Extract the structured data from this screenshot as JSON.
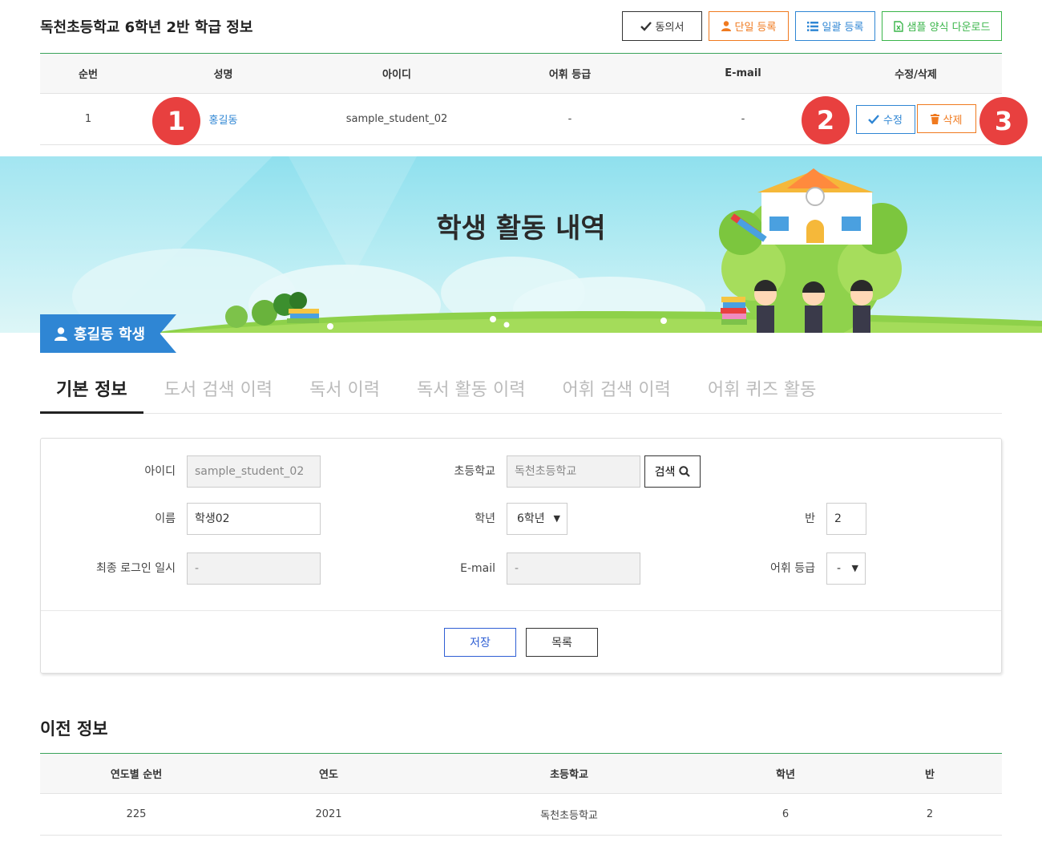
{
  "header": {
    "title": "독천초등학교 6학년 2반 학급 정보",
    "buttons": {
      "consent": "동의서",
      "single_register": "단일 등록",
      "bulk_register": "일괄 등록",
      "sample_download": "샘플 양식 다운로드"
    }
  },
  "student_table": {
    "columns": [
      "순번",
      "성명",
      "아이디",
      "어휘 등급",
      "E-mail",
      "수정/삭제"
    ],
    "rows": [
      {
        "no": "1",
        "name": "홍길동",
        "id": "sample_student_02",
        "vocab_grade": "-",
        "email": "-",
        "edit": "수정",
        "delete": "삭제"
      }
    ]
  },
  "badges": [
    "1",
    "2",
    "3"
  ],
  "banner": {
    "title": "학생 활동 내역",
    "student_tag": "홍길동 학생"
  },
  "tabs": [
    "기본 정보",
    "도서 검색 이력",
    "독서 이력",
    "독서 활동 이력",
    "어휘 검색 이력",
    "어휘 퀴즈 활동"
  ],
  "form": {
    "id_label": "아이디",
    "id_value": "sample_student_02",
    "school_label": "초등학교",
    "school_value": "독천초등학교",
    "search_button": "검색",
    "name_label": "이름",
    "name_value": "학생02",
    "grade_label": "학년",
    "grade_value": "6학년",
    "class_label": "반",
    "class_value": "2",
    "last_login_label": "최종 로그인 일시",
    "last_login_value": "-",
    "email_label": "E-mail",
    "email_value": "-",
    "vocab_label": "어휘 등급",
    "vocab_value": "-",
    "save_button": "저장",
    "list_button": "목록"
  },
  "previous": {
    "title": "이전 정보",
    "columns": [
      "연도별 순번",
      "연도",
      "초등학교",
      "학년",
      "반"
    ],
    "rows": [
      {
        "seq": "225",
        "year": "2021",
        "school": "독천초등학교",
        "grade": "6",
        "class": "2"
      }
    ]
  },
  "colors": {
    "accent_blue": "#2f86d4",
    "accent_orange": "#f07a1f",
    "accent_green": "#3ab54a",
    "badge_red": "#e8403f"
  }
}
